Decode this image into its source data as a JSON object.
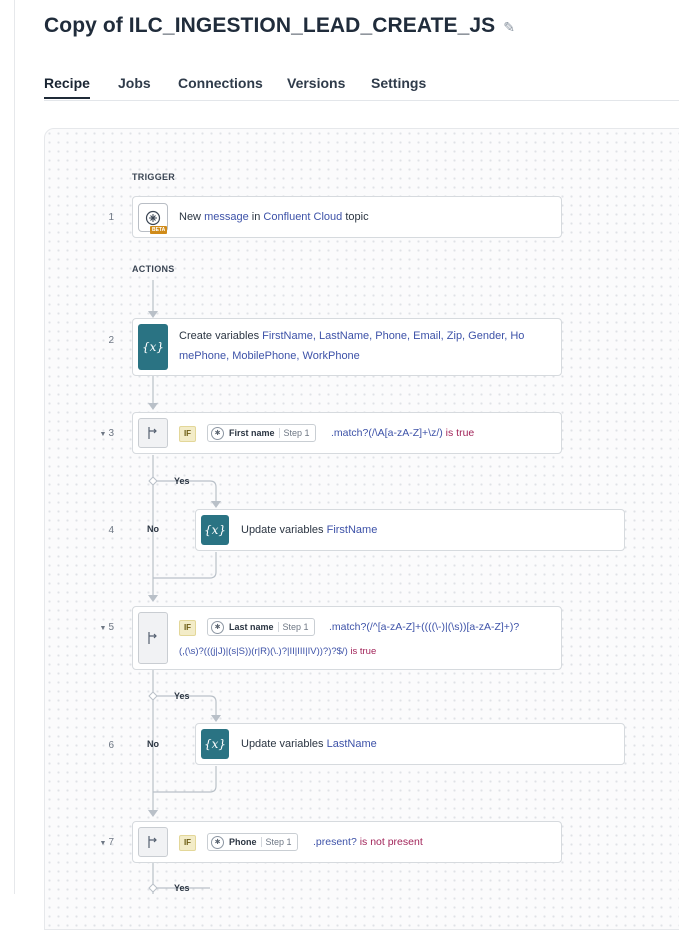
{
  "header": {
    "title": "Copy of ILC_INGESTION_LEAD_CREATE_JS",
    "edit_icon": "pencil-icon"
  },
  "tabs": [
    {
      "label": "Recipe",
      "active": true
    },
    {
      "label": "Jobs"
    },
    {
      "label": "Connections"
    },
    {
      "label": "Versions"
    },
    {
      "label": "Settings"
    }
  ],
  "recipe": {
    "trigger_label": "TRIGGER",
    "actions_label": "ACTIONS",
    "steps": {
      "s1": {
        "number": "1",
        "icon": "confluent-icon",
        "badge": "BETA",
        "t1": "New ",
        "t2": "message",
        "t3": " in ",
        "t4": "Confluent Cloud",
        "t5": " topic"
      },
      "s2": {
        "number": "2",
        "icon": "variable-icon",
        "icon_text": "{x}",
        "line1_a": "Create variables ",
        "line1_b": "FirstName, LastName, Phone, Email, Zip, Gender, Ho",
        "line2": "mePhone, MobilePhone, WorkPhone"
      },
      "s3": {
        "number": "3",
        "if": "IF",
        "pill_name": "First name",
        "pill_step": "Step 1",
        "cond_a": ".match?(/\\A[a-zA-Z]+\\z/)",
        "cond_b": " is true"
      },
      "s4": {
        "number": "4",
        "icon_text": "{x}",
        "text_a": "Update variables ",
        "text_b": "FirstName"
      },
      "s5": {
        "number": "5",
        "if": "IF",
        "pill_name": "Last name",
        "pill_step": "Step 1",
        "cond_line1": ".match?(/^[a-zA-Z]+((((\\-)|(\\s))[a-zA-Z]+)?",
        "cond_line2_a": "(,(\\s)?(((j|J)|(s|S))(r|R)(\\.)?|II|III|IV))?)?$/)",
        "cond_line2_b": " is true"
      },
      "s6": {
        "number": "6",
        "icon_text": "{x}",
        "text_a": "Update variables ",
        "text_b": "LastName"
      },
      "s7": {
        "number": "7",
        "if": "IF",
        "pill_name": "Phone",
        "pill_step": "Step 1",
        "cond_a": ".present?",
        "cond_b": " is not present"
      }
    },
    "branches": {
      "yes": "Yes",
      "no": "No"
    }
  },
  "colors": {
    "accent_teal": "#2a7383",
    "keyword_blue": "#3d52a8",
    "keyword_red": "#a2255a",
    "beta_orange": "#d08b19"
  }
}
